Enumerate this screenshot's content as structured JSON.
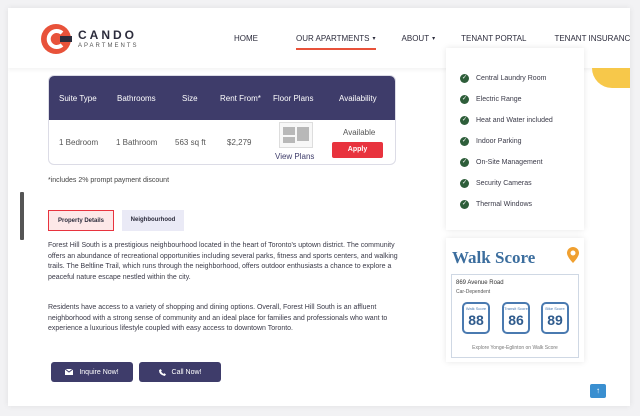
{
  "brand": {
    "name": "CANDO",
    "sub": "APARTMENTS",
    "accent": "#e8523a",
    "primary": "#3e3c6a"
  },
  "nav": [
    {
      "label": "HOME"
    },
    {
      "label": "OUR APARTMENTS",
      "caret": "▾"
    },
    {
      "label": "ABOUT",
      "caret": "▾"
    },
    {
      "label": "TENANT PORTAL"
    },
    {
      "label": "TENANT INSURANCE"
    }
  ],
  "suite_table": {
    "headers": [
      "Suite Type",
      "Bathrooms",
      "Size",
      "Rent From*",
      "Floor Plans",
      "Availability"
    ],
    "row": {
      "suite_type": "1 Bedroom",
      "bathrooms": "1 Bathroom",
      "size": "563 sq ft",
      "rent": "$2,279",
      "floor_plan_link": "View Plans",
      "availability": "Available",
      "apply": "Apply"
    }
  },
  "note": "*includes 2% prompt payment discount",
  "tabs": {
    "property": "Property Details",
    "neighbourhood": "Neighbourhood"
  },
  "description": [
    "Forest Hill South is a prestigious neighbourhood located in the heart of Toronto's uptown district.  The community offers an abundance of recreational opportunities including several parks, fitness and sports centers, and walking trails. The Beltline Trail, which runs through the neighborhood, offers outdoor enthusiasts a chance to explore a peaceful nature escape nestled within the city.",
    "Residents have access to a variety of shopping and dining options. Overall, Forest Hill South is an affluent neighborhood with a strong sense of community and an ideal place for families and professionals who want to experience a luxurious lifestyle coupled with easy access to downtown Toronto."
  ],
  "cta": {
    "inquire": "Inquire Now!",
    "call": "Call Now!"
  },
  "amenities": [
    "Central Laundry Room",
    "Electric Range",
    "Heat and Water included",
    "Indoor Parking",
    "On-Site Management",
    "Security Cameras",
    "Thermal Windows"
  ],
  "walkscore": {
    "logo": "Walk Score",
    "address": "869 Avenue Road",
    "dependency": "Car-Dependent",
    "scores": [
      {
        "label": "Walk Score",
        "value": "88"
      },
      {
        "label": "Transit Score",
        "value": "86"
      },
      {
        "label": "Bike Score",
        "value": "89"
      }
    ],
    "footer": "Explore Yonge-Eglinton on Walk Score"
  },
  "back_to_top": "↑"
}
